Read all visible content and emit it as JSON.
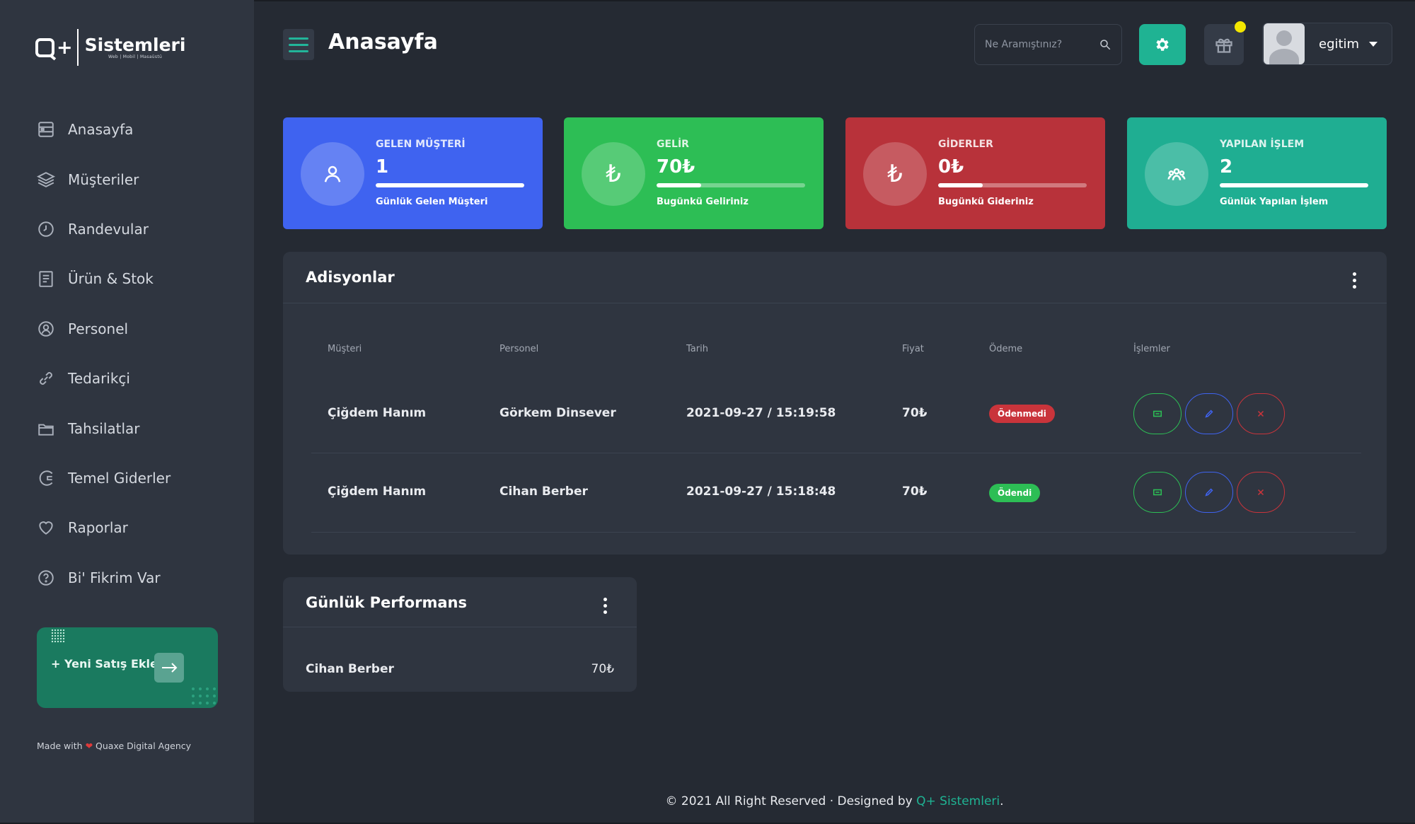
{
  "app": {
    "logo_text": "Sistemleri",
    "logo_sub": "Web | Mobil | Masaüstü",
    "page_title": "Anasayfa"
  },
  "sidebar": {
    "items": [
      {
        "label": "Anasayfa",
        "icon": "dashboard-icon"
      },
      {
        "label": "Müşteriler",
        "icon": "layers-icon"
      },
      {
        "label": "Randevular",
        "icon": "clock-icon"
      },
      {
        "label": "Ürün & Stok",
        "icon": "clipboard-icon"
      },
      {
        "label": "Personel",
        "icon": "user-circle-icon"
      },
      {
        "label": "Tedarikçi",
        "icon": "link-icon"
      },
      {
        "label": "Tahsilatlar",
        "icon": "folder-icon"
      },
      {
        "label": "Temel Giderler",
        "icon": "expense-icon"
      },
      {
        "label": "Raporlar",
        "icon": "heart-icon"
      },
      {
        "label": "Bi' Fikrim Var",
        "icon": "question-icon"
      }
    ],
    "promo_label": "+ Yeni Satış Ekle",
    "made_with_prefix": "Made with",
    "made_with_suffix": "Quaxe Digital Agency"
  },
  "header": {
    "search_placeholder": "Ne Aramıştınız?",
    "username": "egitim",
    "notification_color": "#f3e600"
  },
  "stats": [
    {
      "label": "GELEN MÜŞTERİ",
      "value": "1",
      "sub": "Günlük Gelen Müşteri",
      "color": "#3f63f0",
      "progress": 1.0,
      "icon": "user-icon"
    },
    {
      "label": "GELİR",
      "value": "70₺",
      "sub": "Bugünkü Geliriniz",
      "color": "#2dbe55",
      "progress": 0.3,
      "icon": "lira-icon"
    },
    {
      "label": "GİDERLER",
      "value": "0₺",
      "sub": "Bugünkü Gideriniz",
      "color": "#b8323a",
      "progress": 0.3,
      "icon": "lira-icon"
    },
    {
      "label": "YAPILAN İŞLEM",
      "value": "2",
      "sub": "Günlük Yapılan İşlem",
      "color": "#1fae92",
      "progress": 1.0,
      "icon": "group-icon"
    }
  ],
  "adisyonlar": {
    "title": "Adisyonlar",
    "columns": [
      "Müşteri",
      "Personel",
      "Tarih",
      "Fiyat",
      "Ödeme",
      "İşlemler"
    ],
    "rows": [
      {
        "musteri": "Çiğdem Hanım",
        "personel": "Görkem Dinsever",
        "tarih": "2021-09-27 / 15:19:58",
        "fiyat": "70₺",
        "odeme": "Ödenmedi",
        "odeme_color": "#c9343b"
      },
      {
        "musteri": "Çiğdem Hanım",
        "personel": "Cihan Berber",
        "tarih": "2021-09-27 / 15:18:48",
        "fiyat": "70₺",
        "odeme": "Ödendi",
        "odeme_color": "#2dbe55"
      }
    ]
  },
  "performans": {
    "title": "Günlük Performans",
    "rows": [
      {
        "name": "Cihan Berber",
        "value": "70₺"
      }
    ]
  },
  "footer": {
    "text": "© 2021 All Right Reserved · Designed by",
    "brand": "Q+ Sistemleri",
    "end": "."
  },
  "colors": {
    "accent": "#1fb393",
    "action_view": "#2dbe55",
    "action_edit": "#3f63f0",
    "action_delete": "#c9343b"
  }
}
